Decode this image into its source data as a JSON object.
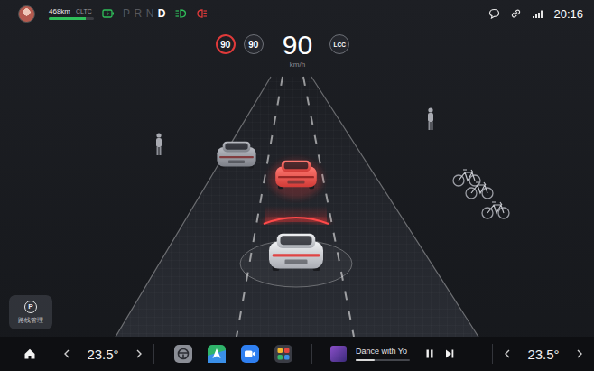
{
  "status_bar": {
    "range": "468km",
    "cycle": "CLTC",
    "battery_level": 0.82,
    "gears": [
      {
        "label": "P",
        "selected": false
      },
      {
        "label": "R",
        "selected": false
      },
      {
        "label": "N",
        "selected": false
      },
      {
        "label": "D",
        "selected": true
      }
    ],
    "time": "20:16"
  },
  "cluster": {
    "speed_limit": "90",
    "set_speed": "90",
    "speed": "90",
    "unit": "km/h",
    "assist_mode": "LCC"
  },
  "scene": {
    "vehicles": [
      {
        "kind": "traffic",
        "alert": false
      },
      {
        "kind": "traffic",
        "alert": true
      },
      {
        "kind": "ego",
        "alert": true
      }
    ]
  },
  "parking_button": {
    "icon": "P",
    "label": "路线管理"
  },
  "dock": {
    "left_temperature": "23.5°",
    "media": {
      "title": "Dance with Yo",
      "playing": true,
      "level": 0.35
    },
    "right_temperature": "23.5°"
  }
}
